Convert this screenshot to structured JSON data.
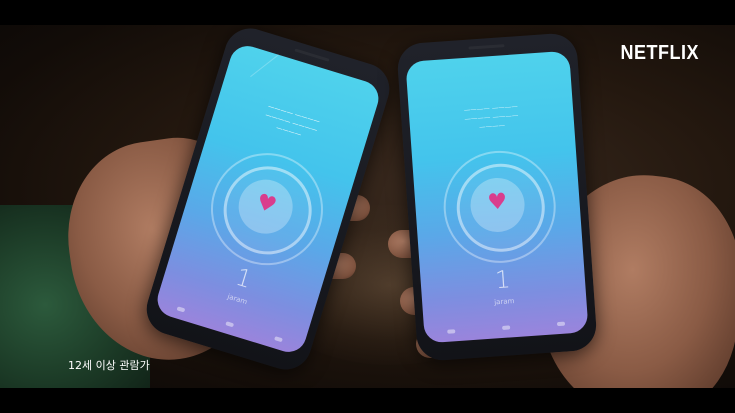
{
  "overlay": {
    "logo": "NETFLIX",
    "age_rating": "12세 이상 관람가"
  },
  "phone_left": {
    "count": "1",
    "unit": "jaram",
    "heart_icon": "heart-icon"
  },
  "phone_right": {
    "count": "1",
    "unit": "jaram",
    "heart_icon": "heart-icon"
  },
  "colors": {
    "screen_top": "#4fd2ec",
    "screen_bottom": "#9a84dc",
    "heart": "#d93d8d"
  }
}
